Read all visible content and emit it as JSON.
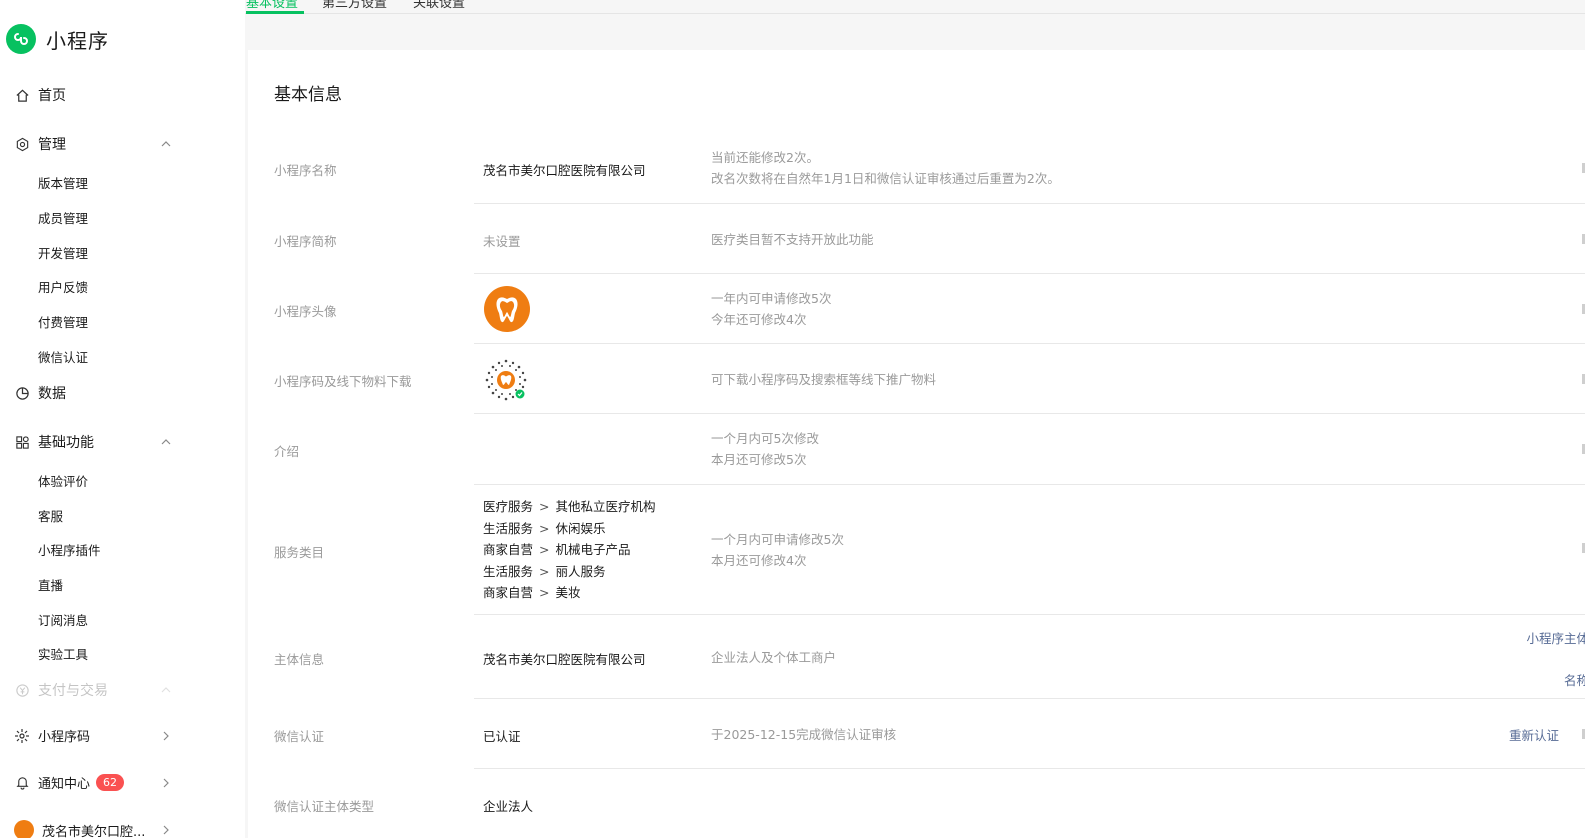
{
  "app": {
    "title": "小程序",
    "colors": {
      "accent": "#07c160",
      "link": "#576b95",
      "badge": "#fa5151",
      "avatar": "#ef7d12"
    }
  },
  "tabs": [
    {
      "label": "基本设置",
      "active": true
    },
    {
      "label": "第三方设置",
      "active": false
    },
    {
      "label": "关联设置",
      "active": false
    }
  ],
  "sidebar": {
    "home": {
      "label": "首页",
      "icon": "home-icon"
    },
    "manage": {
      "label": "管理",
      "icon": "settings-hexagon-icon",
      "expanded": true,
      "items": [
        "版本管理",
        "成员管理",
        "开发管理",
        "用户反馈",
        "付费管理",
        "微信认证"
      ]
    },
    "data": {
      "label": "数据",
      "icon": "pie-chart-icon"
    },
    "basic": {
      "label": "基础功能",
      "icon": "grid-icon",
      "expanded": true,
      "items": [
        "体验评价",
        "客服",
        "小程序插件",
        "直播",
        "订阅消息",
        "实验工具"
      ]
    },
    "payment": {
      "label": "支付与交易",
      "icon": "yen-icon"
    },
    "qrcode": {
      "label": "小程序码",
      "icon": "sun-code-icon"
    },
    "notify": {
      "label": "通知中心",
      "icon": "bell-icon",
      "badge": "62"
    },
    "account": {
      "label": "茂名市美尔口腔..."
    }
  },
  "main": {
    "section_title": "基本信息",
    "rows": {
      "name": {
        "label": "小程序名称",
        "value": "茂名市美尔口腔医院有限公司",
        "tip1": "当前还能修改2次。",
        "tip2": "改名次数将在自然年1月1日和微信认证审核通过后重置为2次。"
      },
      "short": {
        "label": "小程序简称",
        "value": "未设置",
        "tip1": "医疗类目暂不支持开放此功能"
      },
      "avatar": {
        "label": "小程序头像",
        "tip1": "一年内可申请修改5次",
        "tip2": "今年还可修改4次"
      },
      "code": {
        "label": "小程序码及线下物料下载",
        "tip1": "可下载小程序码及搜索框等线下推广物料"
      },
      "intro": {
        "label": "介绍",
        "tip1": "一个月内可5次修改",
        "tip2": "本月还可修改5次"
      },
      "category": {
        "label": "服务类目",
        "items": [
          {
            "parent": "医疗服务",
            "child": "其他私立医疗机构"
          },
          {
            "parent": "生活服务",
            "child": "休闲娱乐"
          },
          {
            "parent": "商家自营",
            "child": "机械电子产品"
          },
          {
            "parent": "生活服务",
            "child": "丽人服务"
          },
          {
            "parent": "商家自营",
            "child": "美妆"
          }
        ],
        "separator": ">",
        "tip1": "一个月内可申请修改5次",
        "tip2": "本月还可修改4次"
      },
      "entity": {
        "label": "主体信息",
        "value": "茂名市美尔口腔医院有限公司",
        "tip1": "企业法人及个体工商户",
        "link1": "小程序主体",
        "link2": "名称"
      },
      "cert": {
        "label": "微信认证",
        "value": "已认证",
        "tip1": "于2025-12-15完成微信认证审核",
        "link1": "重新认证"
      },
      "certType": {
        "label": "微信认证主体类型",
        "value": "企业法人"
      }
    }
  }
}
